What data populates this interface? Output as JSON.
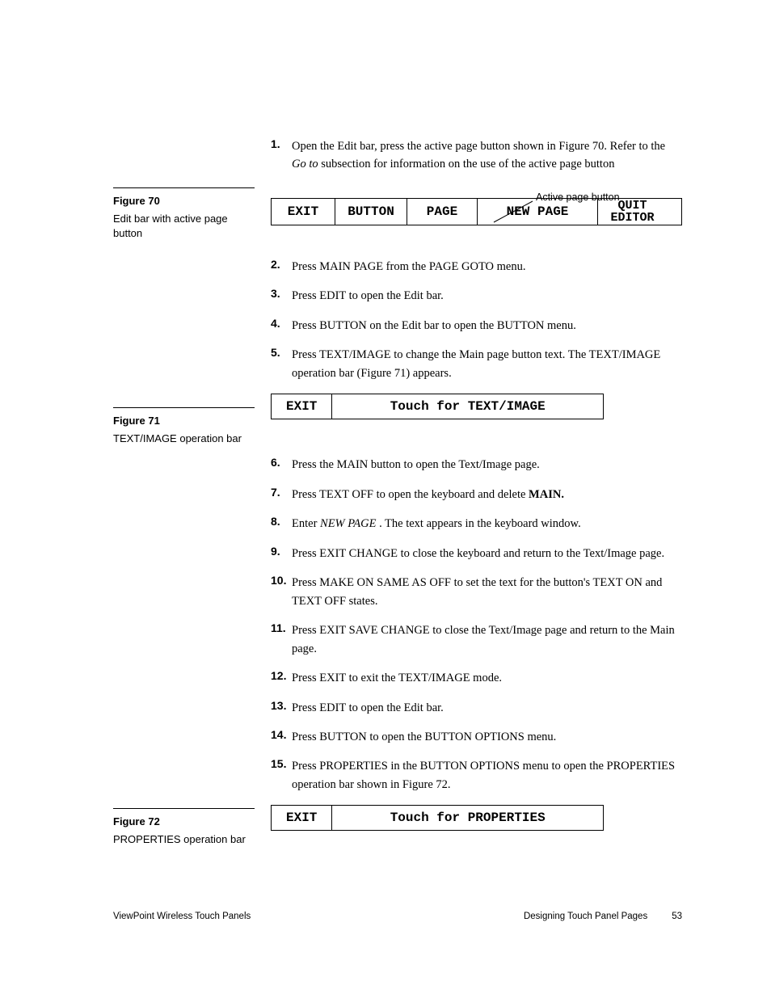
{
  "steps": {
    "s1a": "Open the Edit bar, press the active page button shown in Figure 70. Refer to the ",
    "s1b": "Go to",
    "s1c": " subsection for information on the use of the active page button",
    "s2": "Press MAIN PAGE from the PAGE GOTO menu.",
    "s3": "Press EDIT to open the Edit bar.",
    "s4": "Press BUTTON on the Edit bar to open the BUTTON menu.",
    "s5": "Press TEXT/IMAGE to change the Main page button text. The TEXT/IMAGE operation bar (Figure 71) appears.",
    "s6": "Press the MAIN button to open the Text/Image page.",
    "s7a": "Press TEXT OFF to open the keyboard and delete ",
    "s7b": "MAIN.",
    "s8a": "Enter ",
    "s8b": "NEW PAGE",
    "s8c": " . The text appears in the keyboard window.",
    "s9": "Press EXIT CHANGE to close the keyboard and return to the Text/Image page.",
    "s10": "Press MAKE ON SAME AS OFF to set the text for the button's TEXT ON and TEXT OFF states.",
    "s11": "Press EXIT SAVE CHANGE to close the Text/Image page and return to the Main page.",
    "s12": "Press EXIT to exit the TEXT/IMAGE mode.",
    "s13": "Press EDIT to open the Edit bar.",
    "s14": "Press BUTTON to open the BUTTON OPTIONS menu.",
    "s15": "Press PROPERTIES in the BUTTON OPTIONS menu to open the PROPERTIES operation bar shown in Figure 72."
  },
  "nums": {
    "n1": "1.",
    "n2": "2.",
    "n3": "3.",
    "n4": "4.",
    "n5": "5.",
    "n6": "6.",
    "n7": "7.",
    "n8": "8.",
    "n9": "9.",
    "n10": "10.",
    "n11": "11.",
    "n12": "12.",
    "n13": "13.",
    "n14": "14.",
    "n15": "15."
  },
  "fig70": {
    "title": "Figure 70",
    "caption": "Edit bar with active page button",
    "callout": "Active page button",
    "cells": {
      "exit": "EXIT",
      "button": "BUTTON",
      "page": "PAGE",
      "newpage": "NEW PAGE",
      "quit1": "QUIT",
      "quit2": "EDITOR"
    }
  },
  "fig71": {
    "title": "Figure 71",
    "caption": "TEXT/IMAGE operation bar",
    "exit": "EXIT",
    "text": "Touch for TEXT/IMAGE"
  },
  "fig72": {
    "title": "Figure 72",
    "caption": "PROPERTIES operation bar",
    "exit": "EXIT",
    "text": "Touch for PROPERTIES"
  },
  "footer": {
    "left": "ViewPoint Wireless Touch Panels",
    "right": "Designing Touch Panel Pages",
    "pagenum": "53"
  }
}
